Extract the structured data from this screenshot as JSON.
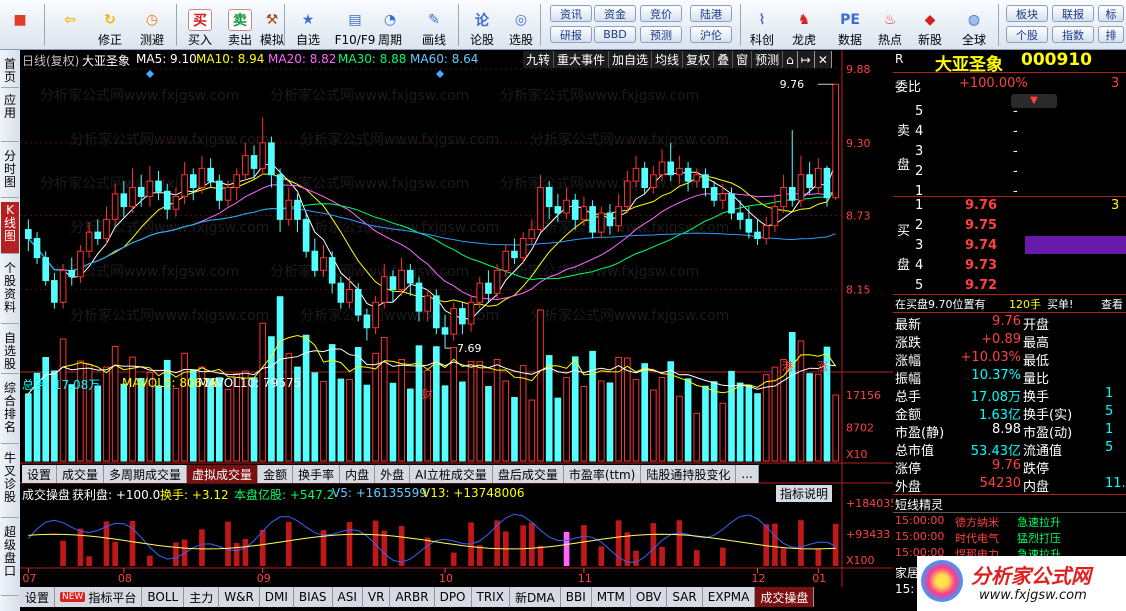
{
  "toolbar": {
    "buttons": [
      {
        "label": "",
        "icon": "windows-icon"
      },
      {
        "label": "",
        "icon": "back-arrow-icon"
      },
      {
        "label": "修正",
        "icon": "refresh-icon"
      },
      {
        "label": "测避",
        "icon": "clock-icon"
      },
      {
        "label": "买入",
        "icon": "buy-icon",
        "glyph": "买"
      },
      {
        "label": "卖出",
        "icon": "sell-icon",
        "glyph": "卖"
      },
      {
        "label": "模拟",
        "icon": "hammer-icon"
      },
      {
        "label": "自选",
        "icon": "star-icon"
      },
      {
        "label": "F10/F9",
        "icon": "info-panel-icon"
      },
      {
        "label": "周期",
        "icon": "cycle-icon"
      },
      {
        "label": "画线",
        "icon": "pencil-icon"
      },
      {
        "label": "论股",
        "icon": "discuss-icon",
        "glyph": "论"
      },
      {
        "label": "选股",
        "icon": "magnifier-icon"
      },
      {
        "label": "科创",
        "icon": "chart-icon"
      },
      {
        "label": "龙虎",
        "icon": "dragon-icon"
      },
      {
        "label": "数据",
        "icon": "pe-icon",
        "glyph": "PE"
      },
      {
        "label": "热点",
        "icon": "fire-icon"
      },
      {
        "label": "新股",
        "icon": "new-stock-icon"
      },
      {
        "label": "全球",
        "icon": "globe-icon"
      }
    ],
    "info_buttons": [
      "资讯",
      "资金",
      "竞价",
      "陆港",
      "研报",
      "BBD",
      "预测",
      "沪伦"
    ],
    "right_buttons": [
      "板块",
      "联报",
      "标",
      "个股",
      "指数",
      "排"
    ]
  },
  "leftnav": {
    "items": [
      "首页",
      "应用",
      "分时图",
      "K线图",
      "个股资料",
      "自选股",
      "综合排名",
      "牛叉诊股",
      "超级盘口"
    ]
  },
  "kline": {
    "header": {
      "period": "日线(复权)",
      "stock": "大亚圣象",
      "ma5": "MA5: 9.10",
      "ma10": "MA10: 8.94",
      "ma20": "MA20: 8.82",
      "ma30": "MA30: 8.88",
      "ma60": "MA60: 8.64"
    },
    "top_tabs": [
      "九转",
      "重大事件",
      "加自选",
      "均线",
      "复权",
      "叠",
      "窗",
      "预测"
    ],
    "price_labels": [
      "9.88",
      "9.30",
      "8.73",
      "8.15"
    ],
    "high_label": "9.76",
    "low_label": "7.69",
    "markers": {
      "cai": "财",
      "gang": "港",
      "zhang": "涨"
    },
    "watermark": "分析家公式网www.fxjgsw.com"
  },
  "volume": {
    "label": "总手: 17.08万",
    "mavol5": "MAVOL5: 80678",
    "mavol10": "MAVOL10: 79575",
    "axis": [
      "17156",
      "8702",
      "X10"
    ]
  },
  "mid_tabs": [
    "设置",
    "成交量",
    "多周期成交量",
    "虚拟成交量",
    "金额",
    "换手率",
    "内盘",
    "外盘",
    "AI立桩成交量",
    "盘后成交量",
    "市盈率(ttm)",
    "陆股通持股变化",
    "..."
  ],
  "indicator": {
    "title": "成交操盘",
    "profit": "获利盘: +100.0",
    "turnover": "换手: +3.12",
    "cost": "本盘亿股: +547.2",
    "v5": "V5: +16135599",
    "v13": "V13: +13748006",
    "explain": "指标说明",
    "axis": [
      "+184035",
      "+93433",
      "X100"
    ]
  },
  "months": [
    "07",
    "08",
    "09",
    "10",
    "11",
    "12",
    "01"
  ],
  "bottom_tabs": [
    "设置",
    "指标平台",
    "BOLL",
    "主力",
    "W&R",
    "DMI",
    "BIAS",
    "ASI",
    "VR",
    "ARBR",
    "DPO",
    "TRIX",
    "新DMA",
    "BBI",
    "MTM",
    "OBV",
    "SAR",
    "EXPMA",
    "成交操盘"
  ],
  "bottom_new_badge": "NEW",
  "quote": {
    "r_label": "R",
    "name": "大亚圣象",
    "code": "000910",
    "weibi_label": "委比",
    "weibi_value": "+100.00%",
    "weibi_extra": "3",
    "sell_label": "卖盘",
    "buy_label": "买盘",
    "sell_levels": [
      {
        "n": "5",
        "p": "-",
        "v": ""
      },
      {
        "n": "4",
        "p": "-",
        "v": ""
      },
      {
        "n": "3",
        "p": "-",
        "v": ""
      },
      {
        "n": "2",
        "p": "-",
        "v": ""
      },
      {
        "n": "1",
        "p": "-",
        "v": ""
      }
    ],
    "buy_levels": [
      {
        "n": "1",
        "p": "9.76",
        "v": "3"
      },
      {
        "n": "2",
        "p": "9.75",
        "v": ""
      },
      {
        "n": "3",
        "p": "9.74",
        "v": ""
      },
      {
        "n": "4",
        "p": "9.73",
        "v": ""
      },
      {
        "n": "5",
        "p": "9.72",
        "v": ""
      }
    ],
    "position_text": "在买盘9.70位置有",
    "position_lots": "120手",
    "position_action": "买单!",
    "position_link": "查看",
    "stats": [
      {
        "l": "最新",
        "v": "9.76",
        "r": "开盘"
      },
      {
        "l": "涨跌",
        "v": "+0.89",
        "r": "最高"
      },
      {
        "l": "涨幅",
        "v": "+10.03%",
        "r": "最低"
      },
      {
        "l": "振幅",
        "v": "10.37%",
        "r": "量比"
      },
      {
        "l": "总手",
        "v": "17.08万",
        "r": "换手",
        "rv": "1"
      },
      {
        "l": "金额",
        "v": "1.63亿",
        "r": "换手(实)",
        "rv": "5"
      },
      {
        "l": "市盈(静)",
        "v": "8.98",
        "r": "市盈(动)",
        "rv": "1"
      },
      {
        "l": "总市值",
        "v": "53.43亿",
        "r": "流通值",
        "rv": "5"
      },
      {
        "l": "涨停",
        "v": "9.76",
        "r": "跌停"
      },
      {
        "l": "外盘",
        "v": "54230",
        "r": "内盘",
        "rv": "11."
      }
    ],
    "news_title": "短线精灵",
    "news": [
      {
        "t": "15:00:00",
        "n": "德方纳米",
        "e": "急速拉升"
      },
      {
        "t": "15:00:00",
        "n": "时代电气",
        "e": "猛烈打压"
      },
      {
        "t": "15:00:00",
        "n": "焊那电力",
        "e": "急速拉升"
      }
    ],
    "bottom_label": "家居",
    "bottom_time": "15:",
    "logo_text": "分析家公式网",
    "logo_url": "www.fxjgsw.com"
  },
  "chart_data": {
    "type": "candlestick",
    "title": "大亚圣象 日线(复权)",
    "x_months": [
      "07",
      "08",
      "09",
      "10",
      "11",
      "12",
      "01"
    ],
    "price_axis": [
      9.88,
      9.3,
      8.73,
      8.15
    ],
    "high": 9.76,
    "low": 7.69,
    "candles": [
      [
        8.62,
        8.55,
        8.7,
        8.45
      ],
      [
        8.55,
        8.4,
        8.6,
        8.35
      ],
      [
        8.4,
        8.22,
        8.45,
        8.18
      ],
      [
        8.22,
        8.05,
        8.28,
        8.0
      ],
      [
        8.05,
        8.3,
        8.35,
        8.0
      ],
      [
        8.3,
        8.25,
        8.4,
        8.18
      ],
      [
        8.25,
        8.45,
        8.5,
        8.2
      ],
      [
        8.45,
        8.6,
        8.68,
        8.4
      ],
      [
        8.6,
        8.55,
        8.7,
        8.5
      ],
      [
        8.55,
        8.7,
        8.8,
        8.5
      ],
      [
        8.7,
        8.9,
        8.98,
        8.65
      ],
      [
        8.9,
        8.8,
        9.0,
        8.72
      ],
      [
        8.8,
        8.95,
        9.1,
        8.75
      ],
      [
        8.95,
        8.88,
        9.05,
        8.8
      ],
      [
        8.88,
        9.0,
        9.12,
        8.8
      ],
      [
        9.0,
        8.92,
        9.08,
        8.85
      ],
      [
        8.92,
        8.78,
        8.98,
        8.7
      ],
      [
        8.78,
        8.88,
        8.95,
        8.72
      ],
      [
        8.88,
        9.05,
        9.15,
        8.82
      ],
      [
        9.05,
        8.95,
        9.1,
        8.85
      ],
      [
        8.95,
        9.1,
        9.2,
        8.9
      ],
      [
        9.1,
        9.0,
        9.18,
        8.95
      ],
      [
        9.0,
        8.85,
        9.05,
        8.78
      ],
      [
        8.85,
        8.95,
        9.0,
        8.8
      ],
      [
        8.95,
        9.05,
        9.1,
        8.85
      ],
      [
        9.05,
        9.2,
        9.3,
        9.0
      ],
      [
        9.2,
        9.1,
        9.28,
        9.02
      ],
      [
        9.1,
        9.3,
        9.5,
        9.05
      ],
      [
        9.3,
        9.05,
        9.35,
        8.95
      ],
      [
        9.05,
        8.7,
        9.1,
        8.6
      ],
      [
        8.7,
        8.85,
        8.95,
        8.65
      ],
      [
        8.85,
        8.7,
        8.9,
        8.6
      ],
      [
        8.7,
        8.45,
        8.75,
        8.4
      ],
      [
        8.45,
        8.3,
        8.55,
        8.25
      ],
      [
        8.3,
        8.4,
        8.5,
        8.25
      ],
      [
        8.4,
        8.2,
        8.45,
        8.12
      ],
      [
        8.2,
        8.05,
        8.25,
        8.0
      ],
      [
        8.05,
        8.15,
        8.25,
        8.0
      ],
      [
        8.15,
        7.95,
        8.2,
        7.9
      ],
      [
        7.95,
        7.85,
        8.0,
        7.75
      ],
      [
        7.85,
        8.05,
        8.1,
        7.8
      ],
      [
        8.05,
        8.25,
        8.35,
        8.0
      ],
      [
        8.25,
        8.15,
        8.3,
        8.05
      ],
      [
        8.15,
        8.3,
        8.4,
        8.1
      ],
      [
        8.3,
        8.2,
        8.35,
        8.1
      ],
      [
        8.2,
        7.98,
        8.25,
        7.9
      ],
      [
        7.98,
        8.1,
        8.15,
        7.9
      ],
      [
        8.1,
        7.85,
        8.15,
        7.8
      ],
      [
        7.85,
        7.8,
        7.95,
        7.69
      ],
      [
        7.8,
        8.0,
        8.05,
        7.75
      ],
      [
        8.0,
        7.88,
        8.05,
        7.8
      ],
      [
        7.88,
        8.05,
        8.1,
        7.82
      ],
      [
        8.05,
        8.2,
        8.25,
        8.0
      ],
      [
        8.2,
        8.12,
        8.3,
        8.05
      ],
      [
        8.12,
        8.3,
        8.35,
        8.08
      ],
      [
        8.3,
        8.45,
        8.5,
        8.25
      ],
      [
        8.45,
        8.4,
        8.55,
        8.35
      ],
      [
        8.4,
        8.55,
        8.6,
        8.35
      ],
      [
        8.55,
        8.62,
        8.7,
        8.5
      ],
      [
        8.62,
        8.95,
        9.05,
        8.6
      ],
      [
        8.95,
        8.8,
        9.0,
        8.7
      ],
      [
        8.8,
        8.75,
        8.9,
        8.68
      ],
      [
        8.75,
        8.85,
        8.95,
        8.7
      ],
      [
        8.85,
        8.7,
        8.9,
        8.62
      ],
      [
        8.7,
        8.8,
        8.88,
        8.65
      ],
      [
        8.8,
        8.6,
        8.85,
        8.55
      ],
      [
        8.6,
        8.75,
        8.8,
        8.55
      ],
      [
        8.75,
        8.65,
        8.82,
        8.58
      ],
      [
        8.65,
        8.8,
        8.9,
        8.6
      ],
      [
        8.8,
        9.0,
        9.08,
        8.75
      ],
      [
        9.0,
        9.1,
        9.2,
        8.95
      ],
      [
        9.1,
        8.95,
        9.15,
        8.9
      ],
      [
        8.95,
        9.05,
        9.12,
        8.9
      ],
      [
        9.05,
        9.15,
        9.25,
        9.0
      ],
      [
        9.15,
        9.05,
        9.3,
        9.0
      ],
      [
        9.05,
        9.1,
        9.2,
        8.98
      ],
      [
        9.1,
        9.0,
        9.15,
        8.92
      ],
      [
        9.0,
        9.05,
        9.1,
        8.95
      ],
      [
        9.05,
        8.95,
        9.1,
        8.88
      ],
      [
        8.95,
        8.85,
        9.0,
        8.8
      ],
      [
        8.85,
        8.9,
        8.98,
        8.78
      ],
      [
        8.9,
        8.75,
        8.95,
        8.7
      ],
      [
        8.75,
        8.7,
        8.85,
        8.62
      ],
      [
        8.7,
        8.6,
        8.8,
        8.55
      ],
      [
        8.6,
        8.55,
        8.7,
        8.5
      ],
      [
        8.55,
        8.65,
        8.72,
        8.5
      ],
      [
        8.65,
        8.8,
        8.9,
        8.6
      ],
      [
        8.8,
        8.95,
        9.05,
        8.75
      ],
      [
        8.95,
        8.85,
        9.4,
        8.8
      ],
      [
        8.85,
        9.05,
        9.2,
        8.8
      ],
      [
        9.05,
        8.95,
        9.15,
        8.9
      ],
      [
        8.95,
        9.1,
        9.18,
        8.9
      ],
      [
        9.1,
        8.87,
        9.12,
        8.8
      ],
      [
        8.87,
        9.76,
        9.76,
        8.85
      ]
    ]
  }
}
